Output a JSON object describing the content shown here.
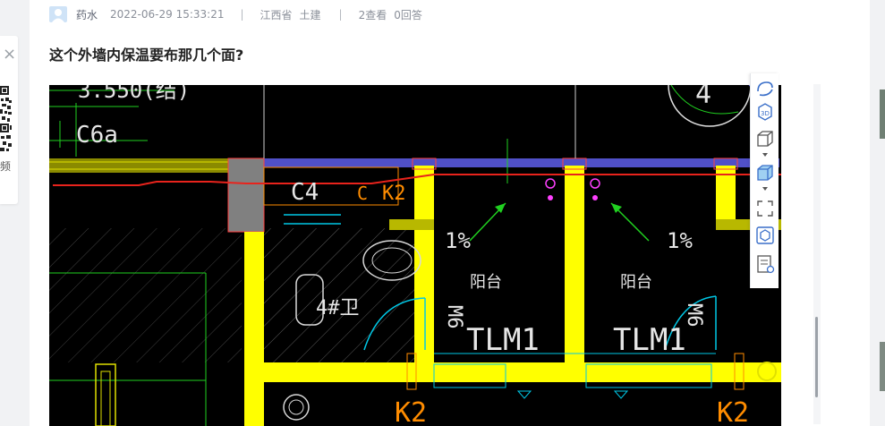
{
  "post": {
    "author": "药水",
    "timestamp": "2022-06-29 15:33:21",
    "separator": "|",
    "province": "江西省",
    "category": "土建",
    "views": "2查看",
    "answers": "0回答",
    "title": "这个外墙内保温要布那几个面?"
  },
  "side_widget": {
    "close_symbol": "×",
    "label": "频"
  },
  "cad": {
    "labels": {
      "elevation": "3.550(结)",
      "window_c6a": "C6a",
      "window_c4": "C4",
      "c": "C",
      "k2_top": "K2",
      "slope_left": "1%",
      "slope_right": "1%",
      "balcony_left": "阳台",
      "balcony_right": "阳台",
      "toilet": "4#卫",
      "m6_left": "M6",
      "m6_right": "M6",
      "door_left": "TLM1",
      "door_right": "TLM1",
      "k2_bottom_left": "K2",
      "k2_bottom_right": "K2",
      "top_right_num": "4"
    }
  },
  "toolbar": {
    "tools": [
      {
        "icon": "rotate-view-icon"
      },
      {
        "icon": "3d-view-icon",
        "label": "3D"
      },
      {
        "icon": "cube-outline-icon"
      },
      {
        "icon": "cube-solid-icon"
      },
      {
        "icon": "fullscreen-icon"
      },
      {
        "icon": "model-box-icon"
      },
      {
        "icon": "layer-settings-icon"
      }
    ]
  },
  "colors": {
    "wall_yellow": "#ffff00",
    "wall_olive": "#b8b800",
    "beam_blue": "#5050c8",
    "markup_red": "#e8231c",
    "cad_bg": "#000000",
    "cyan_line": "#00c8e6",
    "green_line": "#20d020"
  }
}
